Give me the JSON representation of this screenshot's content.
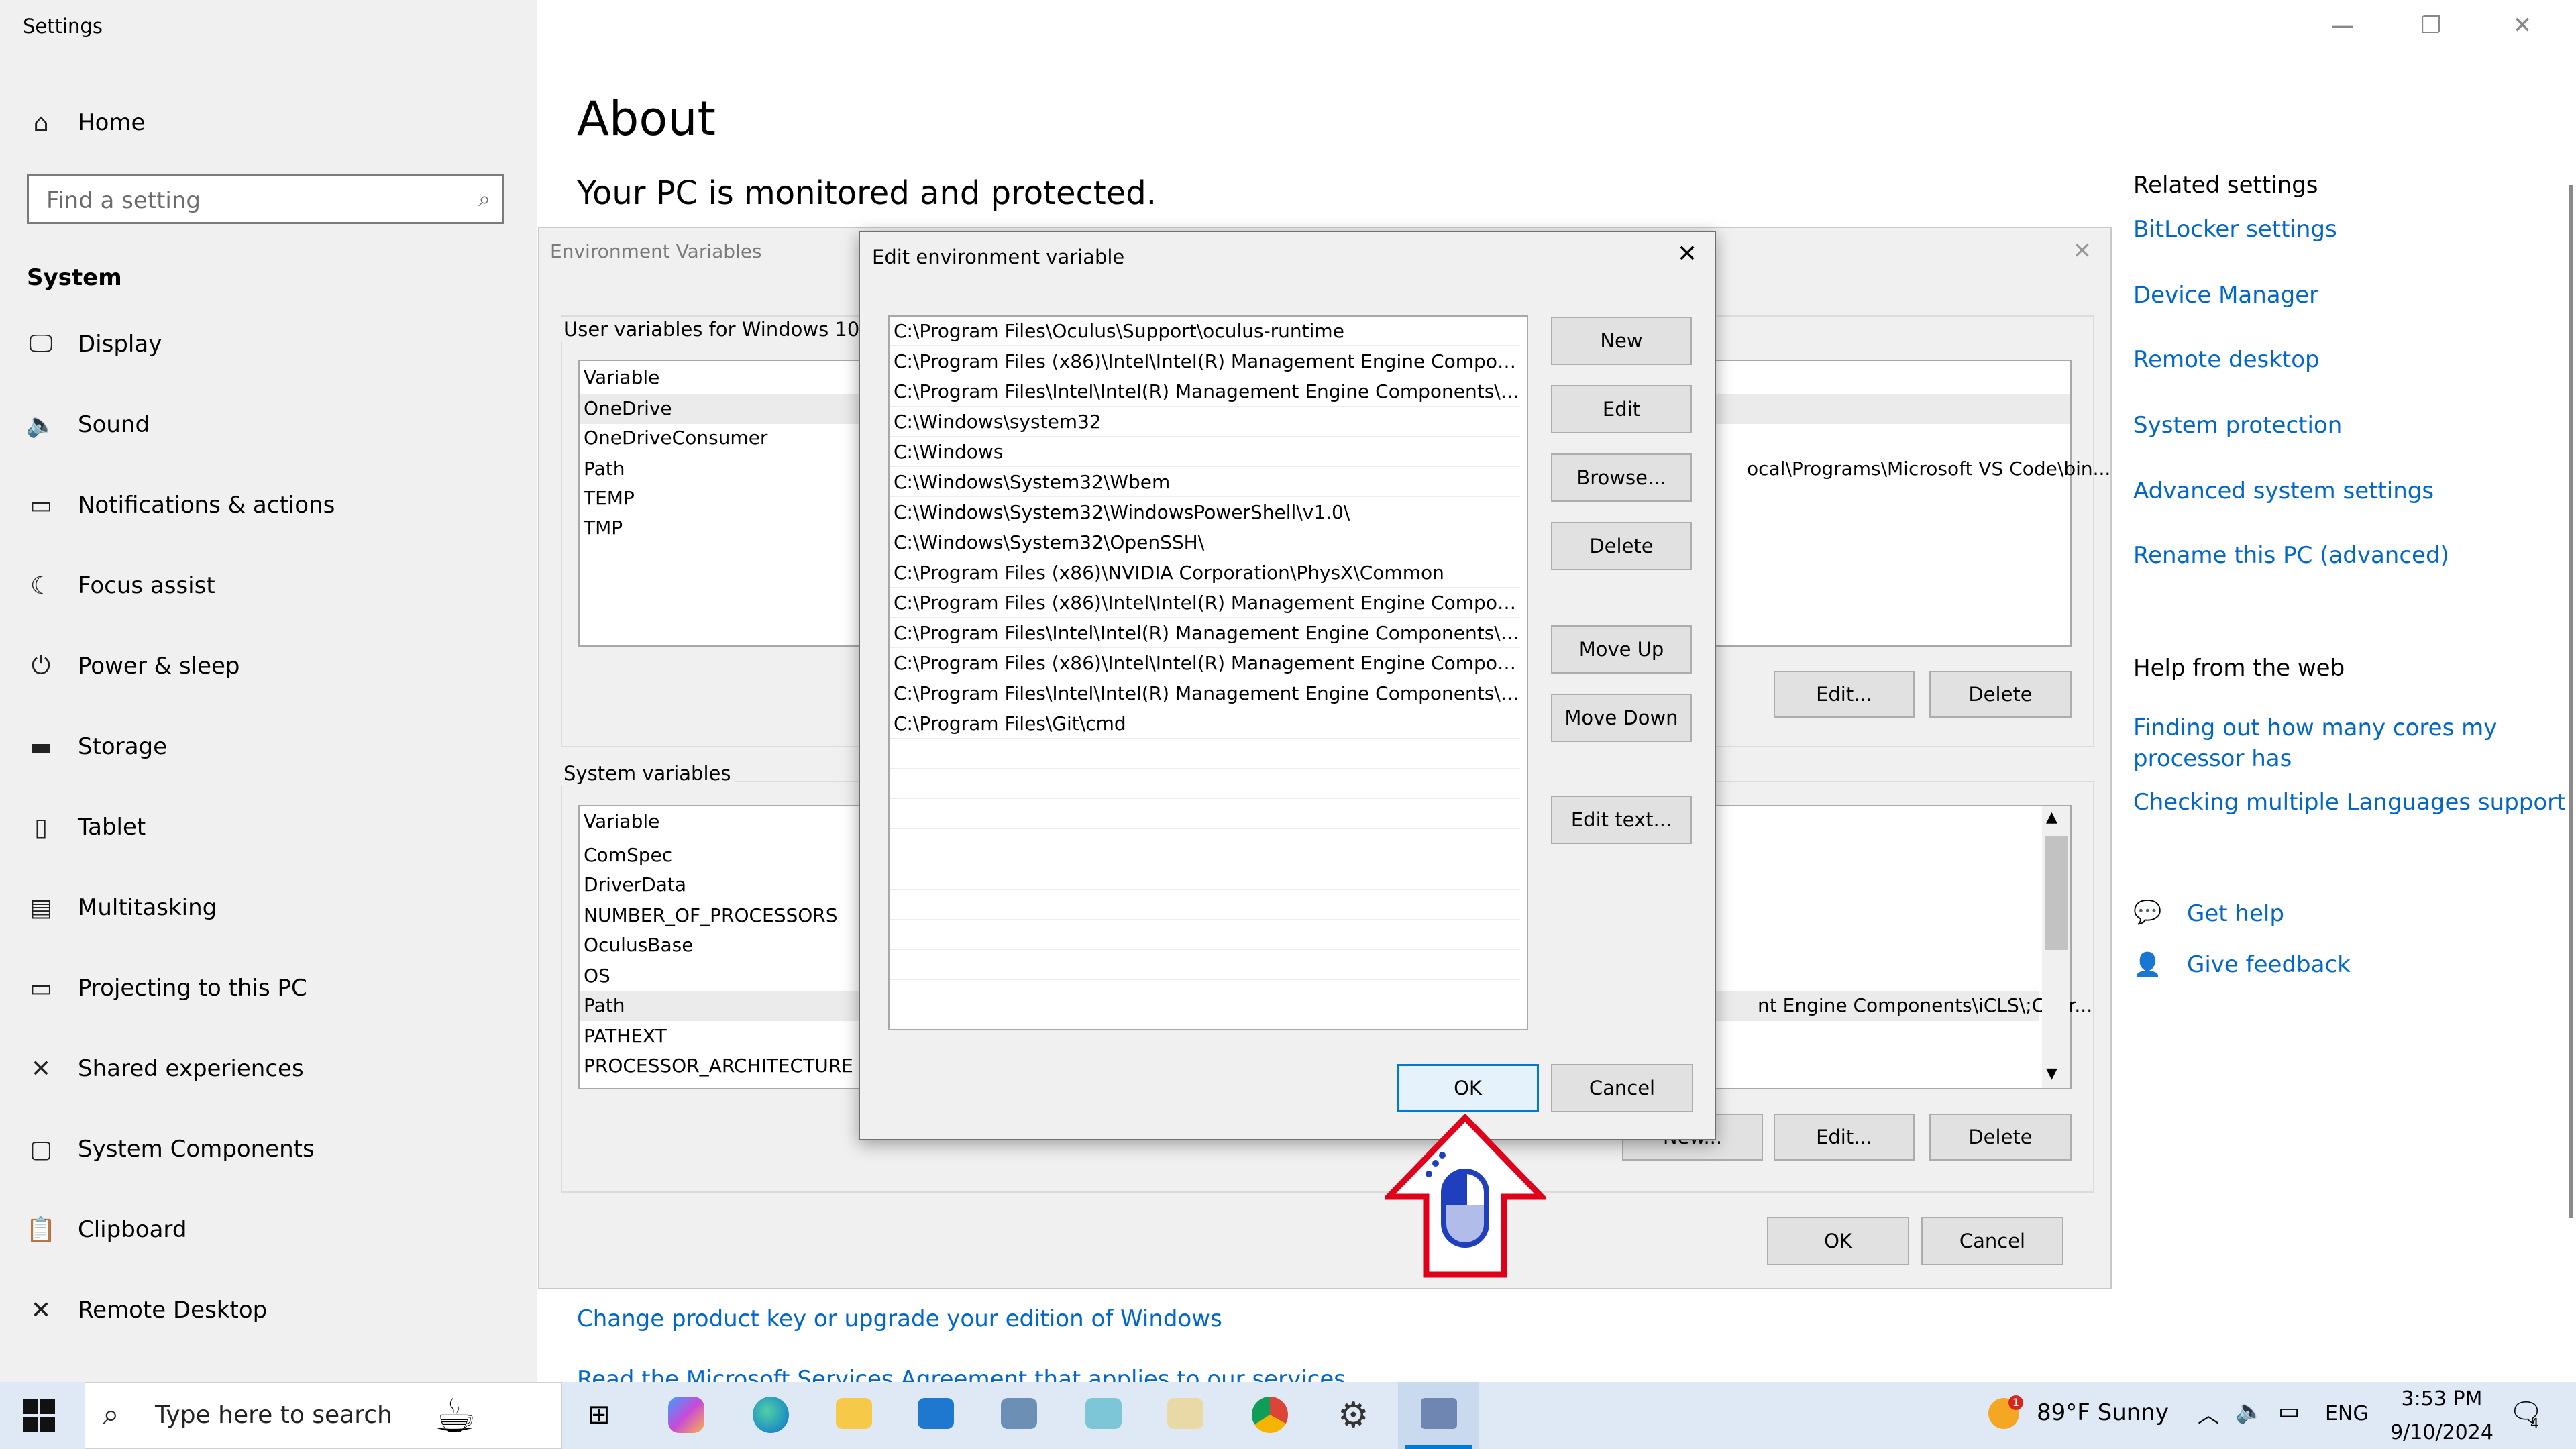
{
  "window": {
    "title": "Settings"
  },
  "nav": {
    "home": "Home",
    "search_placeholder": "Find a setting",
    "section": "System",
    "items": [
      {
        "label": "Display",
        "icon": "monitor-icon"
      },
      {
        "label": "Sound",
        "icon": "speaker-icon"
      },
      {
        "label": "Notifications & actions",
        "icon": "notification-icon"
      },
      {
        "label": "Focus assist",
        "icon": "moon-icon"
      },
      {
        "label": "Power & sleep",
        "icon": "power-icon"
      },
      {
        "label": "Storage",
        "icon": "drive-icon"
      },
      {
        "label": "Tablet",
        "icon": "tablet-icon"
      },
      {
        "label": "Multitasking",
        "icon": "multitasking-icon"
      },
      {
        "label": "Projecting to this PC",
        "icon": "projector-icon"
      },
      {
        "label": "Shared experiences",
        "icon": "share-icon"
      },
      {
        "label": "System Components",
        "icon": "component-icon"
      },
      {
        "label": "Clipboard",
        "icon": "clipboard-icon"
      },
      {
        "label": "Remote Desktop",
        "icon": "remote-icon"
      }
    ]
  },
  "main": {
    "title": "About",
    "status": "Your PC is monitored and protected.",
    "change_key": "Change product key or upgrade your edition of Windows",
    "services_agreement": "Read the Microsoft Services Agreement that applies to our services"
  },
  "related": {
    "heading": "Related settings",
    "links": [
      "BitLocker settings",
      "Device Manager",
      "Remote desktop",
      "System protection",
      "Advanced system settings",
      "Rename this PC (advanced)"
    ]
  },
  "help": {
    "heading": "Help from the web",
    "links": [
      "Finding out how many cores my processor has",
      "Checking multiple Languages support"
    ],
    "get_help": "Get help",
    "give_feedback": "Give feedback"
  },
  "env_window": {
    "title": "Environment Variables",
    "user_label": "User variables for Windows 10",
    "user_header": "Variable",
    "user_vars": [
      "OneDrive",
      "OneDriveConsumer",
      "Path",
      "TEMP",
      "TMP"
    ],
    "user_path_value": "ocal\\Programs\\Microsoft VS Code\\bin...",
    "user_buttons": {
      "edit": "Edit...",
      "delete": "Delete"
    },
    "system_label": "System variables",
    "system_header": "Variable",
    "system_vars": [
      "ComSpec",
      "DriverData",
      "NUMBER_OF_PROCESSORS",
      "OculusBase",
      "OS",
      "Path",
      "PATHEXT",
      "PROCESSOR_ARCHITECTURE"
    ],
    "system_path_value": "nt Engine Components\\iCLS\\;C:\\Pr...",
    "system_buttons": {
      "new": "New...",
      "edit": "Edit...",
      "delete": "Delete"
    },
    "ok": "OK",
    "cancel": "Cancel"
  },
  "edit_dialog": {
    "title": "Edit environment variable",
    "paths": [
      "C:\\Program Files\\Oculus\\Support\\oculus-runtime",
      "C:\\Program Files (x86)\\Intel\\Intel(R) Management Engine Component...",
      "C:\\Program Files\\Intel\\Intel(R) Management Engine Components\\iCLS\\",
      "C:\\Windows\\system32",
      "C:\\Windows",
      "C:\\Windows\\System32\\Wbem",
      "C:\\Windows\\System32\\WindowsPowerShell\\v1.0\\",
      "C:\\Windows\\System32\\OpenSSH\\",
      "C:\\Program Files (x86)\\NVIDIA Corporation\\PhysX\\Common",
      "C:\\Program Files (x86)\\Intel\\Intel(R) Management Engine Component...",
      "C:\\Program Files\\Intel\\Intel(R) Management Engine Components\\DAL",
      "C:\\Program Files (x86)\\Intel\\Intel(R) Management Engine Component...",
      "C:\\Program Files\\Intel\\Intel(R) Management Engine Components\\IPT",
      "C:\\Program Files\\Git\\cmd"
    ],
    "buttons": {
      "new": "New",
      "edit": "Edit",
      "browse": "Browse...",
      "delete": "Delete",
      "move_up": "Move Up",
      "move_down": "Move Down",
      "edit_text": "Edit text..."
    },
    "ok": "OK",
    "cancel": "Cancel"
  },
  "taskbar": {
    "search_placeholder": "Type here to search",
    "weather": "89°F  Sunny",
    "weather_badge": "1",
    "language": "ENG",
    "time": "3:53 PM",
    "date": "9/10/2024",
    "notification_count": "4"
  },
  "colors": {
    "link": "#0066cc",
    "accent": "#0078d7",
    "arrow": "#e0001a",
    "mouse": "#1f3fbf"
  }
}
